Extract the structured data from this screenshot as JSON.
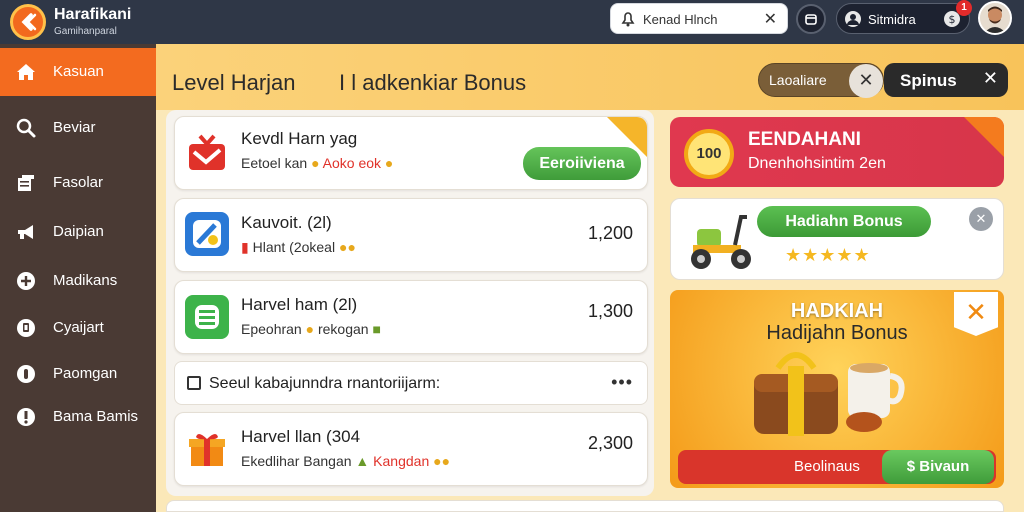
{
  "brand": {
    "title": "Harafikani",
    "subtitle": "Gamihanparal"
  },
  "search": {
    "value": "Kenad Hlnch"
  },
  "user": {
    "name": "Sitmidra",
    "notifications": "1"
  },
  "sidebar": {
    "items": [
      {
        "label": "Kasuan",
        "icon": "home-icon",
        "active": true
      },
      {
        "label": "Beviar",
        "icon": "search-icon"
      },
      {
        "label": "Fasolar",
        "icon": "document-icon"
      },
      {
        "label": "Daipian",
        "icon": "megaphone-icon"
      },
      {
        "label": "Madikans",
        "icon": "plus-circle-icon"
      },
      {
        "label": "Cyaijart",
        "icon": "badge-icon"
      },
      {
        "label": "Paomgan",
        "icon": "info-icon"
      },
      {
        "label": "Bama Bamis",
        "icon": "alert-icon"
      }
    ]
  },
  "header": {
    "title": "Level Harjan",
    "subtitle": "I l adkenkiar Bonus",
    "filter_chip": "Laoaliare",
    "spinus_label": "Spinus"
  },
  "cards": [
    {
      "title": "Kevdl Harn yag",
      "meta_a": "Eetoel kan",
      "meta_b": "Aoko eok",
      "action": "Eeroiiviena",
      "icon": "gift-box-icon"
    },
    {
      "title": "Kauvoit. (2l)",
      "meta_a": "Hlant (2okeal",
      "amount": "1,200",
      "icon": "app-icon"
    },
    {
      "title": "Harvel ham (2l)",
      "meta_a": "Epeohran",
      "meta_b": "rekogan",
      "amount": "1,300",
      "icon": "database-icon"
    },
    {
      "title": "Harvel llan (304",
      "meta_a": "Ekedlihar Bangan",
      "meta_b": "Kangdan",
      "amount": "2,300",
      "icon": "gift-icon"
    }
  ],
  "promo_row": {
    "text": "Seeul kabajunndra rnantoriijarm:"
  },
  "right": {
    "banner": {
      "badge": "100",
      "title": "EENDAHANI",
      "subtitle": "Dnenhohsintim 2en"
    },
    "hadiah_card": {
      "pill": "Hadiahn Bonus",
      "stars": "★★★★★"
    },
    "bonus_panel": {
      "title": "HADKIAH",
      "subtitle": "Hadijahn Bonus",
      "bar_label": "Beolinaus",
      "bar_button": "$ Bivaun"
    }
  },
  "colors": {
    "accent": "#f36b1f",
    "sidebar": "#4a3a34",
    "topbar": "#2f3747",
    "green": "#4caf45",
    "red": "#dc3548"
  }
}
